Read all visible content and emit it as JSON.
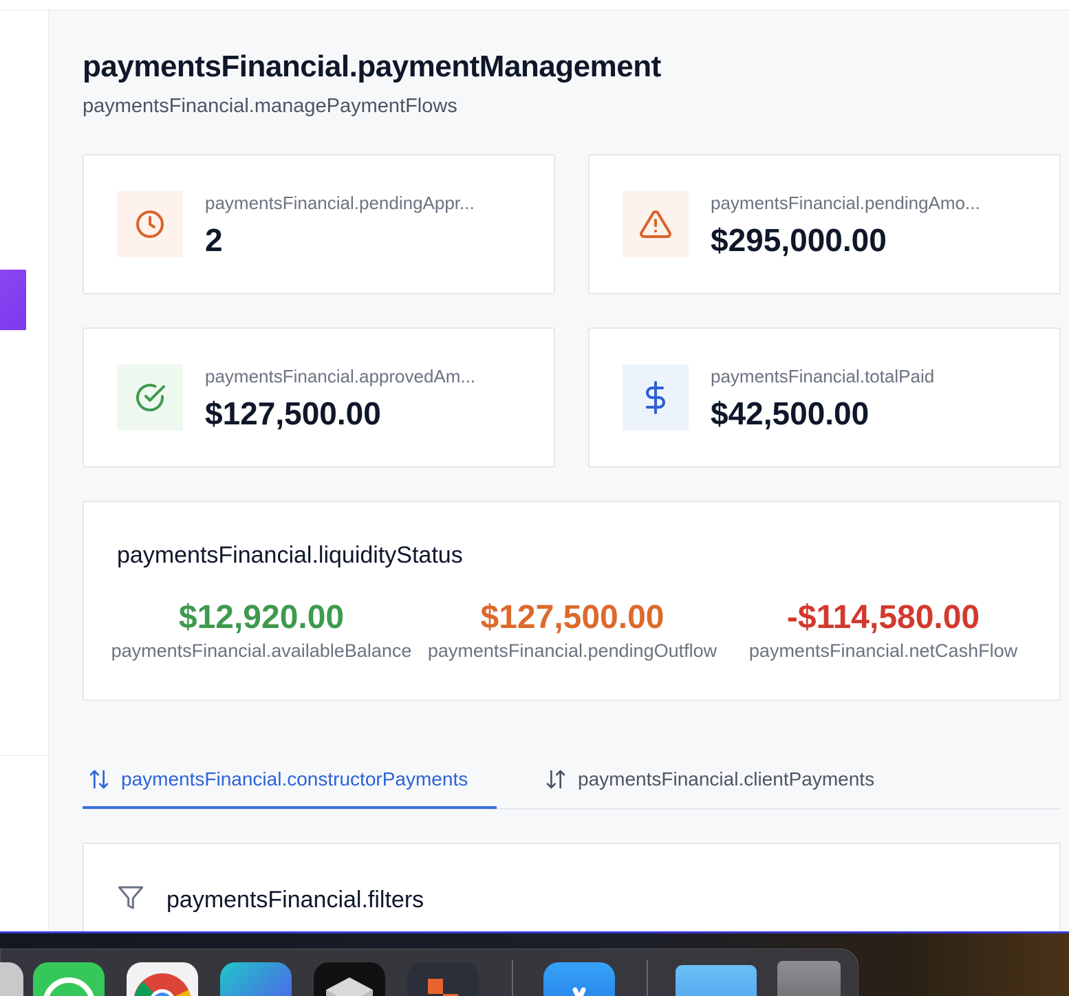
{
  "header": {
    "title": "paymentsFinancial.paymentManagement",
    "subtitle": "paymentsFinancial.managePaymentFlows"
  },
  "stats": [
    {
      "label": "paymentsFinancial.pendingAppr...",
      "value": "2",
      "icon": "clock-icon",
      "color": "#d9632b",
      "bg": "#fdf3ec"
    },
    {
      "label": "paymentsFinancial.pendingAmo...",
      "value": "$295,000.00",
      "icon": "warning-icon",
      "color": "#d9632b",
      "bg": "#fdf3ec"
    },
    {
      "label": "paymentsFinancial.approvedAm...",
      "value": "$127,500.00",
      "icon": "check-circle-icon",
      "color": "#3f9a4e",
      "bg": "#eef8ef"
    },
    {
      "label": "paymentsFinancial.totalPaid",
      "value": "$42,500.00",
      "icon": "dollar-icon",
      "color": "#2f5fd6",
      "bg": "#ecf3fd"
    }
  ],
  "liquidity": {
    "title": "paymentsFinancial.liquidityStatus",
    "items": [
      {
        "value": "$12,920.00",
        "label": "paymentsFinancial.availableBalance",
        "color": "#3f9a4e"
      },
      {
        "value": "$127,500.00",
        "label": "paymentsFinancial.pendingOutflow",
        "color": "#dc6a2c"
      },
      {
        "value": "-$114,580.00",
        "label": "paymentsFinancial.netCashFlow",
        "color": "#d23a2e"
      }
    ]
  },
  "tabs": [
    {
      "label": "paymentsFinancial.constructorPayments",
      "icon": "arrows-up-down-icon",
      "active": true
    },
    {
      "label": "paymentsFinancial.clientPayments",
      "icon": "arrows-down-up-icon",
      "active": false
    }
  ],
  "filters": {
    "title": "paymentsFinancial.filters",
    "icon": "filter-icon"
  },
  "dock": {
    "apps": [
      "whatsapp-icon",
      "chrome-icon",
      "canva-icon",
      "mail-icon",
      "app-icon",
      "app-store-icon",
      "folder-icon",
      "trash-icon"
    ]
  }
}
